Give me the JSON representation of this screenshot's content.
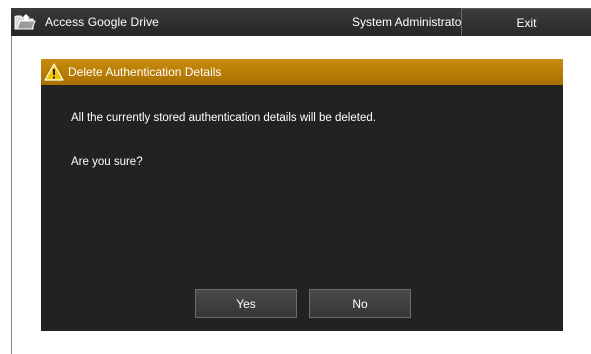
{
  "header": {
    "app_title": "Access Google Drive",
    "user_name": "System Administrator",
    "exit_label": "Exit",
    "icon": "folder-upload-icon"
  },
  "dialog": {
    "title": "Delete Authentication Details",
    "icon": "warning-icon",
    "message": "All the currently stored authentication details will be deleted.",
    "question": "Are you sure?",
    "yes_label": "Yes",
    "no_label": "No"
  },
  "colors": {
    "header_bg": "#2e2e2e",
    "dialog_bg": "#222222",
    "dialog_title_bg": "#b87a05",
    "button_bg": "#404040"
  }
}
